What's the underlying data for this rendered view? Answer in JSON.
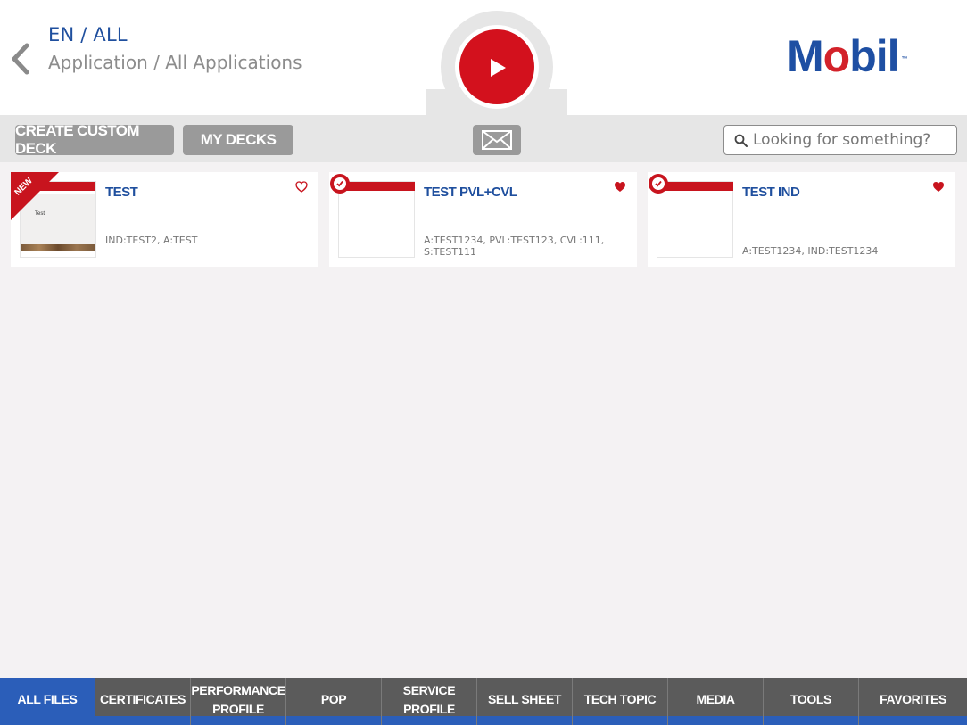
{
  "header": {
    "locale": "EN / ALL",
    "breadcrumb": "Application / All Applications",
    "logo": {
      "prefix": "M",
      "accent": "o",
      "suffix": "bil",
      "tm": "™"
    }
  },
  "toolbar": {
    "create_custom_deck": "CREATE CUSTOM DECK",
    "my_decks": "MY DECKS",
    "search_placeholder": "Looking for something?"
  },
  "cards": [
    {
      "title": "TEST",
      "description": "IND:TEST2, A:TEST",
      "badge": "NEW",
      "thumb_text": "Test",
      "favorite": false
    },
    {
      "title": "TEST PVL+CVL",
      "description": "A:TEST1234, PVL:TEST123, CVL:111, S:TEST111",
      "badge": "check",
      "favorite": true
    },
    {
      "title": "TEST IND",
      "description": "A:TEST1234, IND:TEST1234",
      "badge": "check",
      "favorite": true
    }
  ],
  "nav": {
    "tabs": [
      {
        "label": "ALL FILES",
        "active": true
      },
      {
        "label": "CERTIFICATES"
      },
      {
        "label": "PERFORMANCE PROFILE"
      },
      {
        "label": "POP"
      },
      {
        "label": "SERVICE PROFILE"
      },
      {
        "label": "SELL SHEET"
      },
      {
        "label": "TECH TOPIC"
      },
      {
        "label": "MEDIA"
      },
      {
        "label": "TOOLS"
      },
      {
        "label": "FAVORITES"
      }
    ]
  },
  "colors": {
    "brand_blue": "#1f4f9e",
    "brand_red": "#d3111d",
    "nav_active": "#2b5eb9"
  }
}
